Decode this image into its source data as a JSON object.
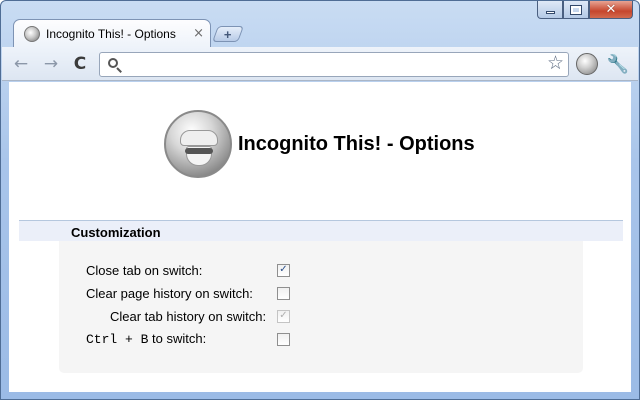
{
  "window": {
    "controls": {
      "minimize": "minimize-icon",
      "maximize": "maximize-icon",
      "close": "close-icon"
    }
  },
  "tab": {
    "title": "Incognito This! - Options",
    "close_glyph": "×",
    "favicon": "globe-icon"
  },
  "newtab": {
    "glyph": "+"
  },
  "toolbar": {
    "back_glyph": "←",
    "forward_glyph": "→",
    "reload_glyph": "C",
    "omnibox": {
      "value": "",
      "placeholder": ""
    },
    "star_glyph": "☆",
    "wrench_glyph": "🔧"
  },
  "page": {
    "title": "Incognito This! - Options",
    "section": "Customization",
    "options": [
      {
        "label": "Close tab on switch:",
        "checked": true,
        "disabled": false
      },
      {
        "label": "Clear page history on switch:",
        "checked": false,
        "disabled": false
      },
      {
        "label": "Clear tab history on switch:",
        "checked": true,
        "disabled": true
      },
      {
        "label_code": "Ctrl + B",
        "label_suffix": " to switch:",
        "checked": false,
        "disabled": false
      }
    ]
  }
}
